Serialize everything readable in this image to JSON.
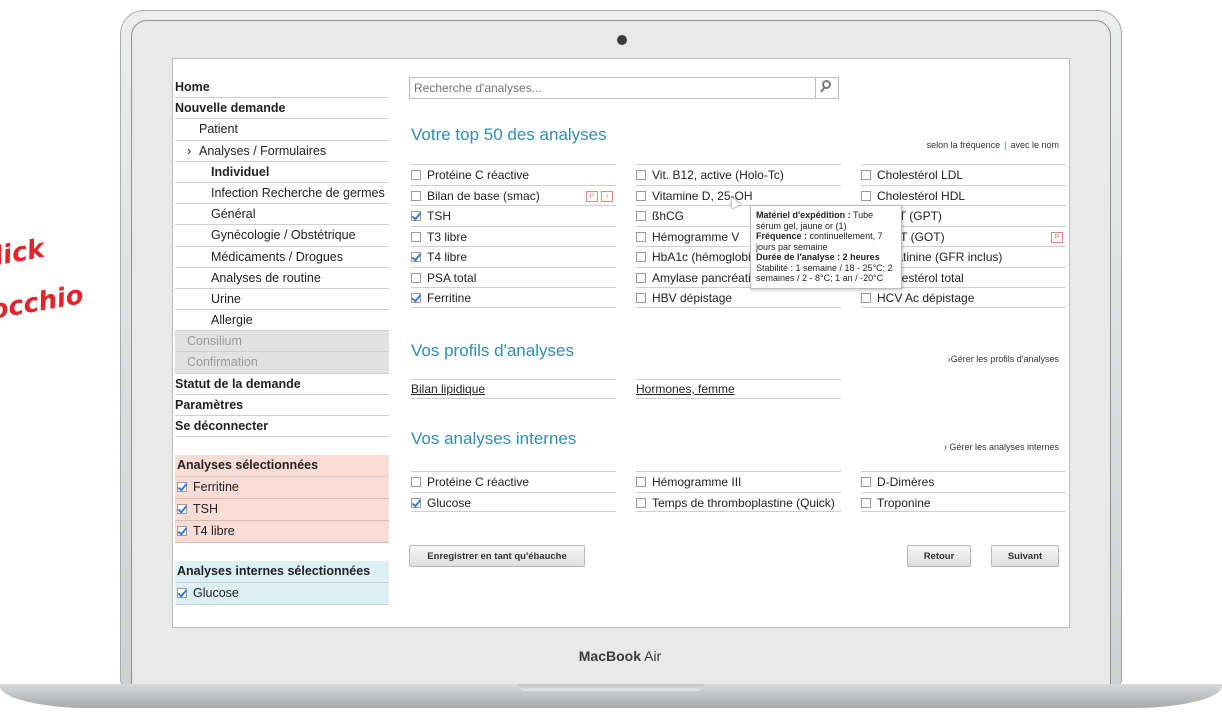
{
  "overlay": {
    "line1": "lick",
    "line2": "occhio"
  },
  "device": {
    "brand_bold": "MacBook",
    "brand_light": "Air"
  },
  "search": {
    "placeholder": "Recherche d'analyses..."
  },
  "sidebar": {
    "items": [
      {
        "label": "Home",
        "style": "b"
      },
      {
        "label": "Nouvelle demande",
        "style": "b"
      },
      {
        "label": "Patient",
        "style": "l1"
      },
      {
        "label": "Analyses / Formulaires",
        "style": "l1",
        "chevron": "›"
      },
      {
        "label": "Individuel",
        "style": "l2b"
      },
      {
        "label": "Infection Recherche de germes",
        "style": "l2"
      },
      {
        "label": "Général",
        "style": "l2"
      },
      {
        "label": "Gynécologie / Obstétrique",
        "style": "l2"
      },
      {
        "label": "Médicaments / Drogues",
        "style": "l2"
      },
      {
        "label": "Analyses de routine",
        "style": "l2"
      },
      {
        "label": "Urine",
        "style": "l2"
      },
      {
        "label": "Allergie",
        "style": "l2"
      },
      {
        "label": "Consilium",
        "style": "dim"
      },
      {
        "label": "Confirmation",
        "style": "dim"
      },
      {
        "label": "Statut de la demande",
        "style": "b"
      },
      {
        "label": "Paramètres",
        "style": "b"
      },
      {
        "label": "Se déconnecter",
        "style": "b"
      }
    ],
    "selected": {
      "title": "Analyses sélectionnées",
      "items": [
        "Ferritine",
        "TSH",
        "T4 libre"
      ]
    },
    "internal_selected": {
      "title": "Analyses internes sélectionnées",
      "items": [
        "Glucose"
      ]
    }
  },
  "top50": {
    "title": "Votre top 50 des analyses",
    "sort_freq": "selon la fréquence",
    "sort_sep": "|",
    "sort_name": "avec le nom",
    "columns": [
      [
        {
          "label": "Protéine C réactive",
          "checked": false
        },
        {
          "label": "Bilan de base (smac)",
          "checked": false,
          "icons": [
            "P",
            "i"
          ]
        },
        {
          "label": "TSH",
          "checked": true
        },
        {
          "label": "T3 libre",
          "checked": false
        },
        {
          "label": "T4 libre",
          "checked": true
        },
        {
          "label": "PSA total",
          "checked": false
        },
        {
          "label": "Ferritine",
          "checked": true
        }
      ],
      [
        {
          "label": "Vit. B12, active (Holo-Tc)",
          "checked": false
        },
        {
          "label": "Vitamine D, 25-OH",
          "checked": false
        },
        {
          "label": "ßhCG",
          "checked": false
        },
        {
          "label": "Hémogramme V",
          "checked": false
        },
        {
          "label": "HbA1c (hémoglobine glyquée)",
          "checked": false
        },
        {
          "label": "Amylase pancréatique",
          "checked": false
        },
        {
          "label": "HBV dépistage",
          "checked": false
        }
      ],
      [
        {
          "label": "Cholestérol LDL",
          "checked": false
        },
        {
          "label": "Cholestérol HDL",
          "checked": false
        },
        {
          "label": "ALAT (GPT)",
          "checked": false
        },
        {
          "label": "ASAT (GOT)",
          "checked": false,
          "icons": [
            "P"
          ]
        },
        {
          "label": "Créatinine (GFR inclus)",
          "checked": false
        },
        {
          "label": "Cholestérol total",
          "checked": false
        },
        {
          "label": "HCV Ac dépistage",
          "checked": false
        }
      ]
    ]
  },
  "tooltip": {
    "l1_bold": "Matériel d'expédition :",
    "l1": "Tube sérum gel, jaune or (1)",
    "l2_bold": "Fréquence :",
    "l2": "continuellement, 7 jours par semaine",
    "l3_bold": "Durée de l'analyse : 2 heures",
    "l4": "Stabilité : 1 semaine / 18 - 25°C; 2 semaines / 2 - 8°C; 1 an / -20°C"
  },
  "profiles": {
    "title": "Vos profils d'analyses",
    "manage": "Gérer les profils d'analyses",
    "items": [
      "Bilan lipidique",
      "Hormones, femme"
    ]
  },
  "internal": {
    "title": "Vos analyses internes",
    "manage": "› Gérer les analyses internes",
    "columns": [
      [
        {
          "label": "Protéine C réactive",
          "checked": false
        },
        {
          "label": "Glucose",
          "checked": true
        }
      ],
      [
        {
          "label": "Hémogramme III",
          "checked": false
        },
        {
          "label": "Temps de thromboplastine (Quick)",
          "checked": false
        }
      ],
      [
        {
          "label": "D-Dimères",
          "checked": false
        },
        {
          "label": "Troponine",
          "checked": false
        }
      ]
    ]
  },
  "buttons": {
    "draft": "Enregistrer en tant qu'ébauche",
    "back": "Retour",
    "next": "Suivant"
  }
}
